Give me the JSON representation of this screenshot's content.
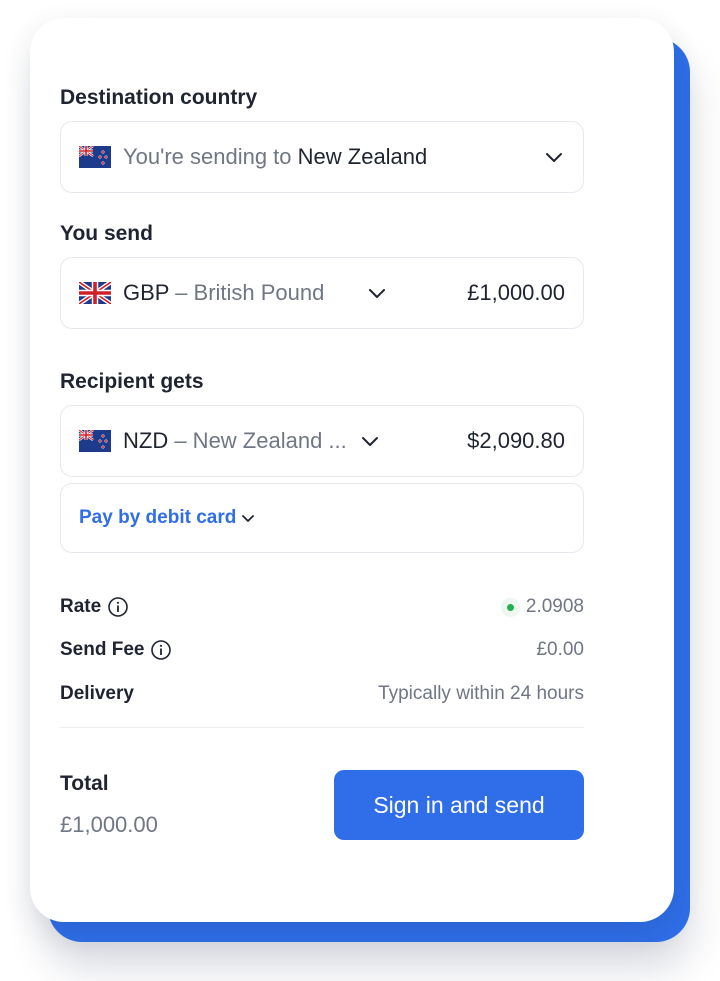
{
  "colors": {
    "accent": "#2f6ee8",
    "status_dot": "#22b14c",
    "muted_text": "#707684",
    "text": "#1f2430"
  },
  "destination": {
    "label": "Destination country",
    "flag": "nz-flag-icon",
    "prefix": "You're sending to ",
    "country": "New Zealand"
  },
  "you_send": {
    "label": "You send",
    "flag": "uk-flag-icon",
    "currency_code": "GBP",
    "currency_name": " – British Pound",
    "amount": "£1,000.00"
  },
  "recipient_gets": {
    "label": "Recipient gets",
    "flag": "nz-flag-icon",
    "currency_code": "NZD",
    "currency_name": " – New Zealand ...",
    "amount": "$2,090.80"
  },
  "payment": {
    "method_label": "Pay by debit card"
  },
  "details": {
    "rate_label": "Rate",
    "rate_value": "2.0908",
    "fee_label": "Send Fee",
    "fee_value": "£0.00",
    "delivery_label": "Delivery",
    "delivery_value": "Typically within 24 hours"
  },
  "total": {
    "label": "Total",
    "value": "£1,000.00"
  },
  "cta": {
    "label": "Sign in and send"
  }
}
